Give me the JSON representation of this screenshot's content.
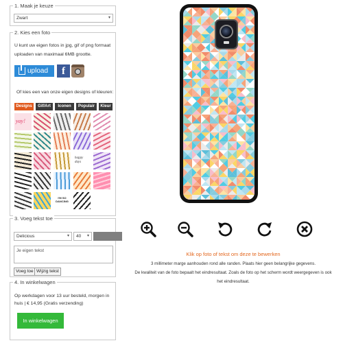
{
  "step1": {
    "title": "1. Maak je keuze",
    "select_value": "Zwart"
  },
  "step2": {
    "title": "2. Kies een foto",
    "intro_line1": "U kunt uw eigen fotos in jpg, gif of png formaat",
    "intro_line2": "uploaden van maximaal 6MB grootte.",
    "upload_label": "upload",
    "facebook_glyph": "f",
    "designs_text": "Of kies een van onze eigen designs of kleuren:",
    "tabs": [
      "Designs",
      "Gif/Art",
      "Iconen",
      "Populair",
      "Kleur"
    ],
    "thumb_texts": [
      "yay!",
      "happy days",
      "I'M SO DANCING"
    ]
  },
  "step3": {
    "title": "3. Voeg tekst toe",
    "font_value": "Delicious",
    "size_value": "40",
    "textarea_placeholder": "Je eigen tekst",
    "add_label": "Voeg toe",
    "edit_label": "Wijzig tekst",
    "swatch_color": "#7f7f7f"
  },
  "step4": {
    "title": "4. In winkelwagen",
    "line1": "Op werkdagen voor 13 uur besteld, morgen in",
    "line2": "huis | € 14,95 (Gratis verzending)",
    "cart_label": "In winkelwagen",
    "cart_color": "#34b93a"
  },
  "editor": {
    "tools": [
      "zoom-in-icon",
      "zoom-out-icon",
      "rotate-left-icon",
      "rotate-right-icon",
      "delete-icon"
    ],
    "hint_orange": "Klik op foto of tekst om deze te bewerken",
    "hint_line1": "3 millimeter marge aanhouden rond alle randen. Plaats hier geen belangrijke gegevens.",
    "hint_line2": "De kwaliteit van de foto bepaalt het eindresultaat. Zoals de foto op het scherm wordt weergegeven is ook",
    "hint_line3": "het eindresultaat.",
    "accent_color": "#e3671e"
  }
}
